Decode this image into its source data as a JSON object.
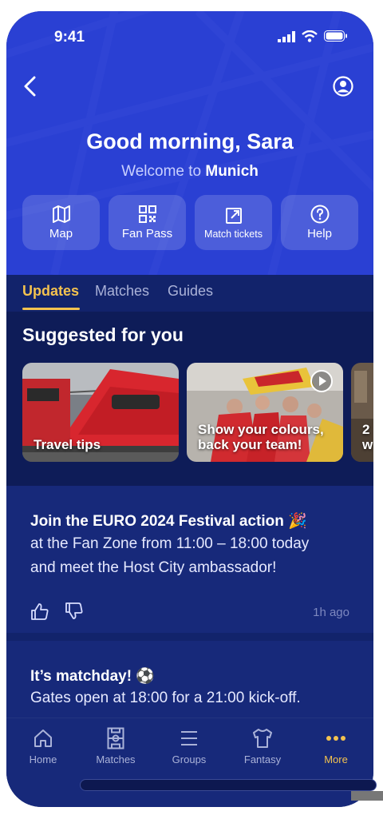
{
  "status": {
    "time": "9:41"
  },
  "header": {
    "greeting": "Good morning, Sara",
    "welcome_prefix": "Welcome to",
    "city": "Munich"
  },
  "quick_actions": [
    {
      "label": "Map",
      "icon": "map-icon"
    },
    {
      "label": "Fan Pass",
      "icon": "qr-code-icon"
    },
    {
      "label": "Match tickets",
      "icon": "external-link-icon"
    },
    {
      "label": "Help",
      "icon": "help-circle-icon"
    }
  ],
  "tabs": [
    {
      "label": "Updates",
      "active": true
    },
    {
      "label": "Matches",
      "active": false
    },
    {
      "label": "Guides",
      "active": false
    }
  ],
  "suggested": {
    "title": "Suggested for you",
    "cards": [
      {
        "caption": "Travel tips",
        "image": "red train"
      },
      {
        "caption_line1": "Show your colours,",
        "caption_line2": "back your team!",
        "image": "fans in stadium",
        "video": true
      },
      {
        "caption_line1": "2",
        "caption_line2": "w"
      }
    ]
  },
  "posts": [
    {
      "title": "Join the EURO 2024 Festival action 🎉",
      "line1": "at the Fan Zone from 11:00 – 18:00 today",
      "line2": "and meet the Host City ambassador!",
      "time": "1h ago"
    },
    {
      "title": "It’s matchday! ⚽",
      "line1": "Gates open at 18:00 for a 21:00 kick-off."
    }
  ],
  "tabbar": [
    {
      "label": "Home",
      "icon": "home-icon",
      "active": false
    },
    {
      "label": "Matches",
      "icon": "pitch-icon",
      "active": false
    },
    {
      "label": "Groups",
      "icon": "list-icon",
      "active": false
    },
    {
      "label": "Fantasy",
      "icon": "shirt-icon",
      "active": false
    },
    {
      "label": "More",
      "icon": "more-dots-icon",
      "active": true
    }
  ],
  "colors": {
    "primary": "#2a40d3",
    "dark": "#12236b",
    "accent": "#f3c24f"
  }
}
